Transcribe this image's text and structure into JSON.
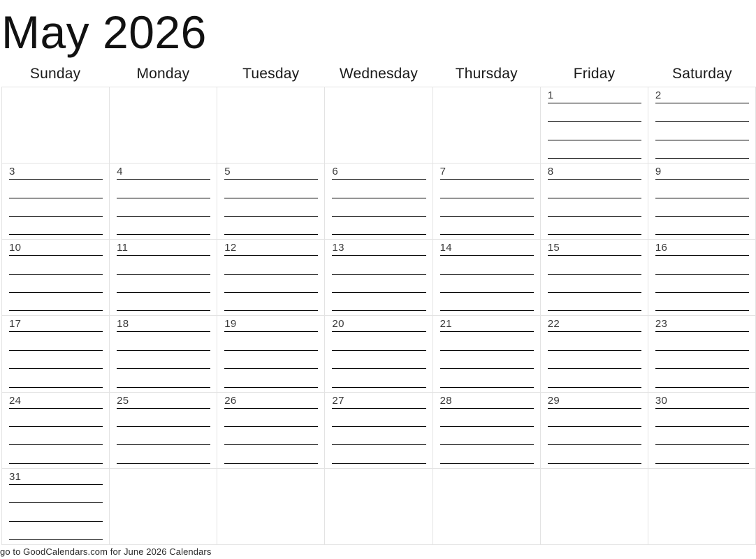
{
  "header": {
    "title": "May 2026"
  },
  "weekdays": [
    {
      "label": "Sunday"
    },
    {
      "label": "Monday"
    },
    {
      "label": "Tuesday"
    },
    {
      "label": "Wednesday"
    },
    {
      "label": "Thursday"
    },
    {
      "label": "Friday"
    },
    {
      "label": "Saturday"
    }
  ],
  "grid": {
    "columns": 7,
    "rows": 6,
    "lines_per_day": 4,
    "cells": [
      {
        "day": ""
      },
      {
        "day": ""
      },
      {
        "day": ""
      },
      {
        "day": ""
      },
      {
        "day": ""
      },
      {
        "day": "1"
      },
      {
        "day": "2"
      },
      {
        "day": "3"
      },
      {
        "day": "4"
      },
      {
        "day": "5"
      },
      {
        "day": "6"
      },
      {
        "day": "7"
      },
      {
        "day": "8"
      },
      {
        "day": "9"
      },
      {
        "day": "10"
      },
      {
        "day": "11"
      },
      {
        "day": "12"
      },
      {
        "day": "13"
      },
      {
        "day": "14"
      },
      {
        "day": "15"
      },
      {
        "day": "16"
      },
      {
        "day": "17"
      },
      {
        "day": "18"
      },
      {
        "day": "19"
      },
      {
        "day": "20"
      },
      {
        "day": "21"
      },
      {
        "day": "22"
      },
      {
        "day": "23"
      },
      {
        "day": "24"
      },
      {
        "day": "25"
      },
      {
        "day": "26"
      },
      {
        "day": "27"
      },
      {
        "day": "28"
      },
      {
        "day": "29"
      },
      {
        "day": "30"
      },
      {
        "day": "31"
      },
      {
        "day": ""
      },
      {
        "day": ""
      },
      {
        "day": ""
      },
      {
        "day": ""
      },
      {
        "day": ""
      },
      {
        "day": ""
      }
    ]
  },
  "footer": {
    "text": "go to GoodCalendars.com for June 2026 Calendars"
  },
  "colors": {
    "grid_line": "#e3e3e3",
    "write_line": "#000000",
    "day_number": "#3a3a3a",
    "title": "#111111",
    "background": "#ffffff"
  }
}
